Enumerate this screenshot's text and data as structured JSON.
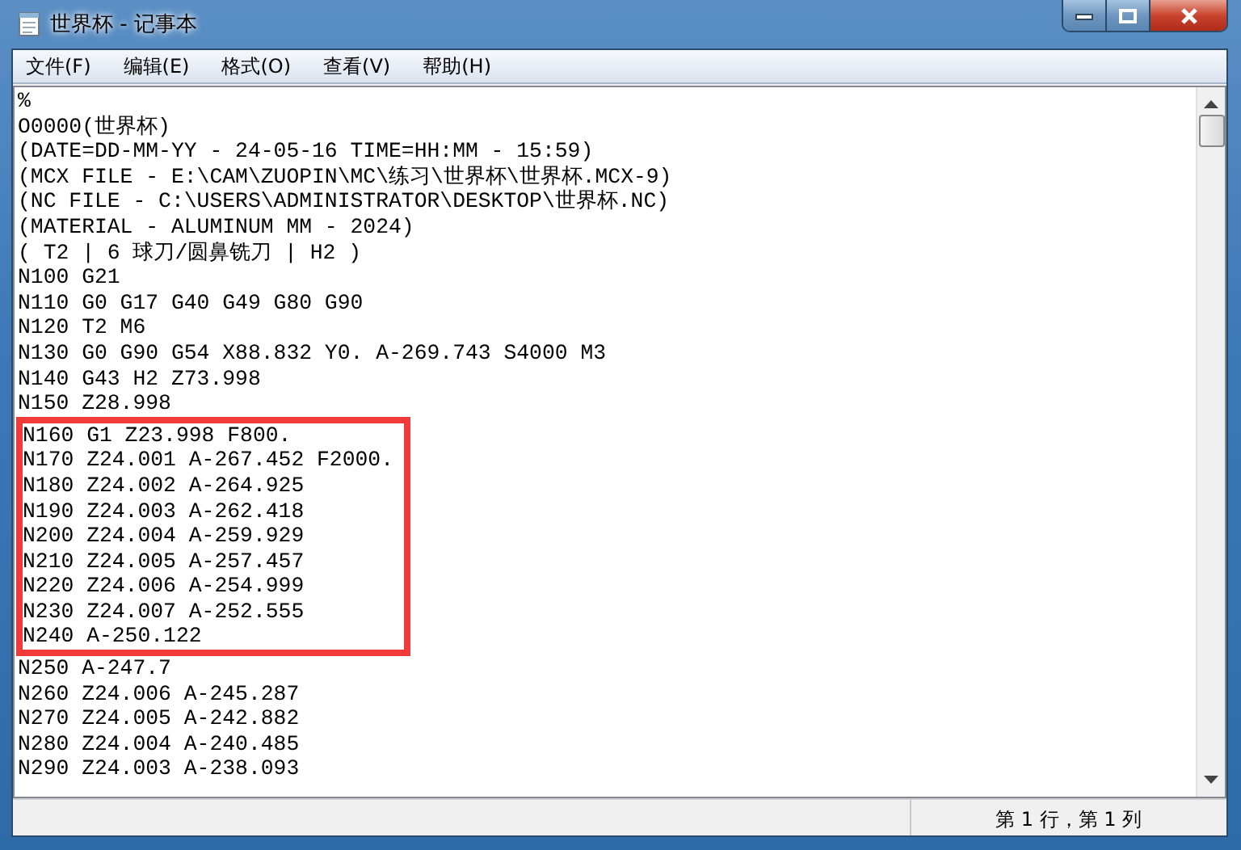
{
  "window": {
    "title": "世界杯 - 记事本"
  },
  "title_buttons": [
    {
      "kind": "minimize"
    },
    {
      "kind": "maximize"
    },
    {
      "kind": "close"
    }
  ],
  "menu": [
    "文件(F)",
    "编辑(E)",
    "格式(O)",
    "查看(V)",
    "帮助(H)"
  ],
  "editor": {
    "lines": [
      {
        "text": "%",
        "highlighted": false
      },
      {
        "text": "O0000(世界杯)",
        "highlighted": false
      },
      {
        "text": "(DATE=DD-MM-YY - 24-05-16 TIME=HH:MM - 15:59)",
        "highlighted": false
      },
      {
        "text": "(MCX FILE - E:\\CAM\\ZUOPIN\\MC\\练习\\世界杯\\世界杯.MCX-9)",
        "highlighted": false
      },
      {
        "text": "(NC FILE - C:\\USERS\\ADMINISTRATOR\\DESKTOP\\世界杯.NC)",
        "highlighted": false
      },
      {
        "text": "(MATERIAL - ALUMINUM MM - 2024)",
        "highlighted": false
      },
      {
        "text": "( T2 | 6 球刀/圆鼻铣刀 | H2 )",
        "highlighted": false
      },
      {
        "text": "N100 G21",
        "highlighted": false
      },
      {
        "text": "N110 G0 G17 G40 G49 G80 G90",
        "highlighted": false
      },
      {
        "text": "N120 T2 M6",
        "highlighted": false
      },
      {
        "text": "N130 G0 G90 G54 X88.832 Y0. A-269.743 S4000 M3",
        "highlighted": false
      },
      {
        "text": "N140 G43 H2 Z73.998",
        "highlighted": false
      },
      {
        "text": "N150 Z28.998",
        "highlighted": false
      },
      {
        "text": "N160 G1 Z23.998 F800.",
        "highlighted": true
      },
      {
        "text": "N170 Z24.001 A-267.452 F2000.",
        "highlighted": true
      },
      {
        "text": "N180 Z24.002 A-264.925",
        "highlighted": true
      },
      {
        "text": "N190 Z24.003 A-262.418",
        "highlighted": true
      },
      {
        "text": "N200 Z24.004 A-259.929",
        "highlighted": true
      },
      {
        "text": "N210 Z24.005 A-257.457",
        "highlighted": true
      },
      {
        "text": "N220 Z24.006 A-254.999",
        "highlighted": true
      },
      {
        "text": "N230 Z24.007 A-252.555",
        "highlighted": true
      },
      {
        "text": "N240 A-250.122",
        "highlighted": true
      },
      {
        "text": "N250 A-247.7",
        "highlighted": false
      },
      {
        "text": "N260 Z24.006 A-245.287",
        "highlighted": false
      },
      {
        "text": "N270 Z24.005 A-242.882",
        "highlighted": false
      },
      {
        "text": "N280 Z24.004 A-240.485",
        "highlighted": false
      },
      {
        "text": "N290 Z24.003 A-238.093",
        "highlighted": false
      }
    ]
  },
  "status_bar": {
    "position": "第 1 行，第 1 列"
  }
}
